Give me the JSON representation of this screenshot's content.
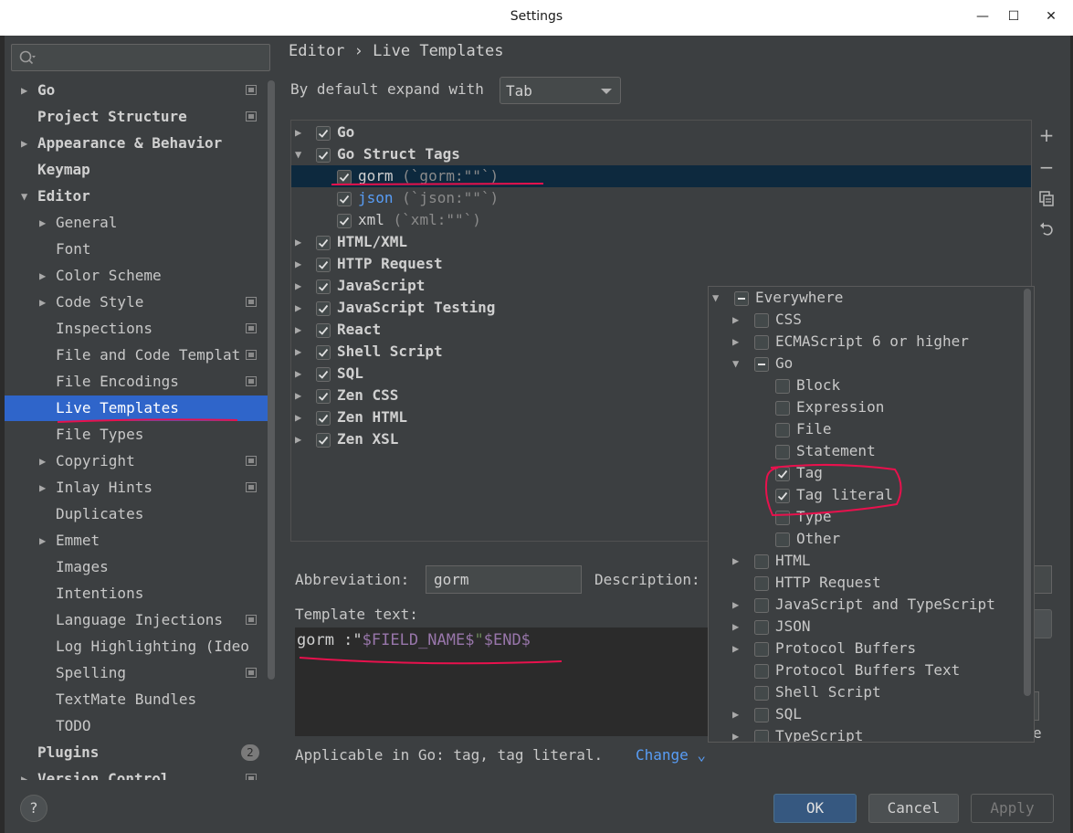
{
  "window": {
    "title": "Settings",
    "minimize_glyph": "—",
    "maximize_glyph": "☐",
    "close_glyph": "✕"
  },
  "sidebar": {
    "search_placeholder": "",
    "items": [
      {
        "label": "Go",
        "arrow": "▶",
        "indent": 0,
        "bold": true,
        "proj": true
      },
      {
        "label": "Project Structure",
        "arrow": "",
        "indent": 0,
        "bold": true,
        "proj": true
      },
      {
        "label": "Appearance & Behavior",
        "arrow": "▶",
        "indent": 0,
        "bold": true,
        "proj": false
      },
      {
        "label": "Keymap",
        "arrow": "",
        "indent": 0,
        "bold": true,
        "proj": false
      },
      {
        "label": "Editor",
        "arrow": "▼",
        "indent": 0,
        "bold": true,
        "proj": false
      },
      {
        "label": "General",
        "arrow": "▶",
        "indent": 1,
        "bold": false,
        "proj": false
      },
      {
        "label": "Font",
        "arrow": "",
        "indent": 1,
        "bold": false,
        "proj": false
      },
      {
        "label": "Color Scheme",
        "arrow": "▶",
        "indent": 1,
        "bold": false,
        "proj": false
      },
      {
        "label": "Code Style",
        "arrow": "▶",
        "indent": 1,
        "bold": false,
        "proj": true
      },
      {
        "label": "Inspections",
        "arrow": "",
        "indent": 1,
        "bold": false,
        "proj": true
      },
      {
        "label": "File and Code Templat",
        "arrow": "",
        "indent": 1,
        "bold": false,
        "proj": true
      },
      {
        "label": "File Encodings",
        "arrow": "",
        "indent": 1,
        "bold": false,
        "proj": true
      },
      {
        "label": "Live Templates",
        "arrow": "",
        "indent": 1,
        "bold": false,
        "proj": false,
        "selected": true
      },
      {
        "label": "File Types",
        "arrow": "",
        "indent": 1,
        "bold": false,
        "proj": false
      },
      {
        "label": "Copyright",
        "arrow": "▶",
        "indent": 1,
        "bold": false,
        "proj": true
      },
      {
        "label": "Inlay Hints",
        "arrow": "▶",
        "indent": 1,
        "bold": false,
        "proj": true
      },
      {
        "label": "Duplicates",
        "arrow": "",
        "indent": 1,
        "bold": false,
        "proj": false
      },
      {
        "label": "Emmet",
        "arrow": "▶",
        "indent": 1,
        "bold": false,
        "proj": false
      },
      {
        "label": "Images",
        "arrow": "",
        "indent": 1,
        "bold": false,
        "proj": false
      },
      {
        "label": "Intentions",
        "arrow": "",
        "indent": 1,
        "bold": false,
        "proj": false
      },
      {
        "label": "Language Injections",
        "arrow": "",
        "indent": 1,
        "bold": false,
        "proj": true
      },
      {
        "label": "Log Highlighting (Ideo",
        "arrow": "",
        "indent": 1,
        "bold": false,
        "proj": false
      },
      {
        "label": "Spelling",
        "arrow": "",
        "indent": 1,
        "bold": false,
        "proj": true
      },
      {
        "label": "TextMate Bundles",
        "arrow": "",
        "indent": 1,
        "bold": false,
        "proj": false
      },
      {
        "label": "TODO",
        "arrow": "",
        "indent": 1,
        "bold": false,
        "proj": false
      },
      {
        "label": "Plugins",
        "arrow": "",
        "indent": 0,
        "bold": true,
        "proj": false,
        "badge": "2"
      },
      {
        "label": "Version Control",
        "arrow": "▶",
        "indent": 0,
        "bold": true,
        "proj": true
      }
    ]
  },
  "header": {
    "breadcrumb_parent": "Editor",
    "breadcrumb_sep": "›",
    "breadcrumb_current": "Live Templates"
  },
  "expand": {
    "label": "By default expand with",
    "value": "Tab"
  },
  "templates": [
    {
      "label": "Go",
      "desc": "",
      "arrow": "▶",
      "level": 0,
      "checked": true,
      "group": true
    },
    {
      "label": "Go Struct Tags",
      "desc": "",
      "arrow": "▼",
      "level": 0,
      "checked": true,
      "group": true
    },
    {
      "label": "gorm",
      "desc": " (`gorm:\"\"`)",
      "arrow": "",
      "level": 1,
      "checked": true,
      "group": false,
      "selected": true
    },
    {
      "label": "json",
      "desc": " (`json:\"\"`)",
      "arrow": "",
      "level": 1,
      "checked": true,
      "group": false,
      "blue": true
    },
    {
      "label": "xml",
      "desc": " (`xml:\"\"`)",
      "arrow": "",
      "level": 1,
      "checked": true,
      "group": false
    },
    {
      "label": "HTML/XML",
      "desc": "",
      "arrow": "▶",
      "level": 0,
      "checked": true,
      "group": true
    },
    {
      "label": "HTTP Request",
      "desc": "",
      "arrow": "▶",
      "level": 0,
      "checked": true,
      "group": true
    },
    {
      "label": "JavaScript",
      "desc": "",
      "arrow": "▶",
      "level": 0,
      "checked": true,
      "group": true
    },
    {
      "label": "JavaScript Testing",
      "desc": "",
      "arrow": "▶",
      "level": 0,
      "checked": true,
      "group": true
    },
    {
      "label": "React",
      "desc": "",
      "arrow": "▶",
      "level": 0,
      "checked": true,
      "group": true
    },
    {
      "label": "Shell Script",
      "desc": "",
      "arrow": "▶",
      "level": 0,
      "checked": true,
      "group": true
    },
    {
      "label": "SQL",
      "desc": "",
      "arrow": "▶",
      "level": 0,
      "checked": true,
      "group": true
    },
    {
      "label": "Zen CSS",
      "desc": "",
      "arrow": "▶",
      "level": 0,
      "checked": true,
      "group": true
    },
    {
      "label": "Zen HTML",
      "desc": "",
      "arrow": "▶",
      "level": 0,
      "checked": true,
      "group": true
    },
    {
      "label": "Zen XSL",
      "desc": "",
      "arrow": "▶",
      "level": 0,
      "checked": true,
      "group": true
    }
  ],
  "toolbar": {
    "add_glyph": "+",
    "remove_glyph": "−"
  },
  "fields": {
    "abbreviation_label": "Abbreviation:",
    "abbreviation_value": "gorm",
    "description_label": "Description:",
    "template_text_label": "Template text:",
    "template_text_prefix": "gorm :\"",
    "template_text_var": "$FIELD_NAME$",
    "template_text_quote": "\"",
    "template_text_end": "$END$",
    "option_edge_text": "e",
    "applicable_text": "Applicable in Go: tag, tag literal.",
    "change_link": "Change ⌄"
  },
  "context_popup": {
    "items": [
      {
        "label": "Everywhere",
        "arrow": "▼",
        "level": 0,
        "state": "partial"
      },
      {
        "label": "CSS",
        "arrow": "▶",
        "level": 1,
        "state": "unchecked"
      },
      {
        "label": "ECMAScript 6 or higher",
        "arrow": "▶",
        "level": 1,
        "state": "unchecked"
      },
      {
        "label": "Go",
        "arrow": "▼",
        "level": 1,
        "state": "partial"
      },
      {
        "label": "Block",
        "arrow": "",
        "level": 2,
        "state": "unchecked"
      },
      {
        "label": "Expression",
        "arrow": "",
        "level": 2,
        "state": "unchecked"
      },
      {
        "label": "File",
        "arrow": "",
        "level": 2,
        "state": "unchecked"
      },
      {
        "label": "Statement",
        "arrow": "",
        "level": 2,
        "state": "unchecked"
      },
      {
        "label": "Tag",
        "arrow": "",
        "level": 2,
        "state": "checked"
      },
      {
        "label": "Tag literal",
        "arrow": "",
        "level": 2,
        "state": "checked"
      },
      {
        "label": "Type",
        "arrow": "",
        "level": 2,
        "state": "unchecked"
      },
      {
        "label": "Other",
        "arrow": "",
        "level": 2,
        "state": "unchecked"
      },
      {
        "label": "HTML",
        "arrow": "▶",
        "level": 1,
        "state": "unchecked"
      },
      {
        "label": "HTTP Request",
        "arrow": "",
        "level": 1,
        "state": "unchecked"
      },
      {
        "label": "JavaScript and TypeScript",
        "arrow": "▶",
        "level": 1,
        "state": "unchecked"
      },
      {
        "label": "JSON",
        "arrow": "▶",
        "level": 1,
        "state": "unchecked"
      },
      {
        "label": "Protocol Buffers",
        "arrow": "▶",
        "level": 1,
        "state": "unchecked"
      },
      {
        "label": "Protocol Buffers Text",
        "arrow": "",
        "level": 1,
        "state": "unchecked"
      },
      {
        "label": "Shell Script",
        "arrow": "",
        "level": 1,
        "state": "unchecked"
      },
      {
        "label": "SQL",
        "arrow": "▶",
        "level": 1,
        "state": "unchecked"
      },
      {
        "label": "TypeScript",
        "arrow": "▶",
        "level": 1,
        "state": "unchecked"
      }
    ]
  },
  "footer": {
    "help": "?",
    "ok": "OK",
    "cancel": "Cancel",
    "apply": "Apply"
  },
  "colors": {
    "accent_selected": "#2f65ca",
    "row_selected": "#0d293e",
    "link": "#589df6",
    "annotation": "#e8114d"
  }
}
